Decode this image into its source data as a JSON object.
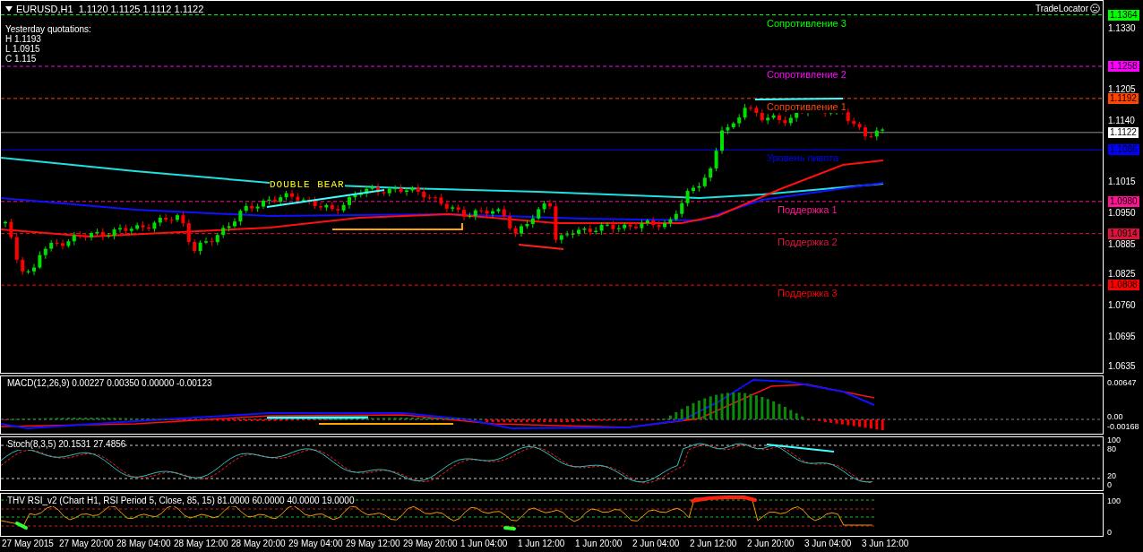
{
  "header": {
    "symbol_line": "EURUSD,H1  1.1120 1.1125 1.1112 1.1122",
    "indicator_name": "TradeLocator"
  },
  "yesterday": {
    "title": "Yesterday quotations:",
    "lines": [
      "H 1.1193",
      "L 1.0915",
      "C 1.115"
    ]
  },
  "pattern_label": "DOUBLE BEAR",
  "levels": [
    {
      "label": "Сопротивление 3",
      "price": "1.1364",
      "color": "#00ff00",
      "kind": "resistance"
    },
    {
      "label": "Сопротивление 2",
      "price": "1.1258",
      "color": "#ff00ff",
      "kind": "resistance"
    },
    {
      "label": "Сопротивление 1",
      "price": "1.1192",
      "color": "#ff4500",
      "kind": "resistance"
    },
    {
      "label": "Уровень пивота",
      "price": "1.1086",
      "color": "#0000ff",
      "kind": "pivot"
    },
    {
      "label": "Поддержка 1",
      "price": "1.0980",
      "color": "#ff1493",
      "kind": "support"
    },
    {
      "label": "Поддержка 2",
      "price": "1.0914",
      "color": "#dc143c",
      "kind": "support"
    },
    {
      "label": "Поддержка 3",
      "price": "1.0808",
      "color": "#ff0000",
      "kind": "support"
    }
  ],
  "current_price": {
    "price": "1.1122"
  },
  "price_axis": [
    "1.1330",
    "1.1205",
    "1.1140",
    "1.1015",
    "1.0950",
    "1.0885",
    "1.0825",
    "1.0760",
    "1.0695",
    "1.0635"
  ],
  "macd": {
    "title": "MACD(12,26,9) 0.00227 0.00350 0.00000 -0.00123",
    "axis": [
      "0.00647",
      "0.00",
      "-0.00168"
    ]
  },
  "stoch": {
    "title": "Stoch(8,3,5) 20.1531 27.4856",
    "axis": [
      "100",
      "80",
      "20",
      "0"
    ]
  },
  "rsi": {
    "title": "THV RSI_v2 (Chart H1, RSI Period 5, Close, 85, 15) 81.0000 60.0000 40.0000 19.0000",
    "axis": [
      "100",
      "0"
    ]
  },
  "time_axis": [
    "27 May 2015",
    "27 May 20:00",
    "28 May 04:00",
    "28 May 12:00",
    "28 May 20:00",
    "29 May 04:00",
    "29 May 12:00",
    "29 May 20:00",
    "1 Jun 04:00",
    "1 Jun 12:00",
    "1 Jun 20:00",
    "2 Jun 04:00",
    "2 Jun 12:00",
    "2 Jun 20:00",
    "3 Jun 04:00",
    "3 Jun 12:00"
  ]
}
